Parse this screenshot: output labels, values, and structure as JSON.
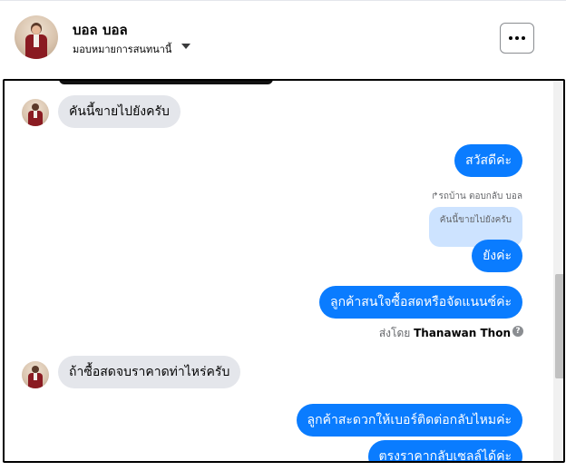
{
  "header": {
    "name": "บอล บอล",
    "assign_label": "มอบหมายการสนทนานี้",
    "more_label": "..."
  },
  "messages": {
    "m1": "คันนี้ขายไปยังครับ",
    "m2": "สวัสดีค่ะ",
    "reply_label": "รถบ้าน ตอบกลับ บอล",
    "quoted": "คันนี้ขายไปยังครับ",
    "m3": "ยังค่ะ",
    "m4": "ลูกค้าสนใจซื้อสดหรือจัดแนนซ์ค่ะ",
    "sent_by_prefix": "ส่งโดย",
    "sent_by_name": "Thanawan Thon",
    "help": "?",
    "m5": "ถ้าซื้อสดจบราคาดท่าไหร่ครับ",
    "m6": "ลูกค้าสะดวกให้เบอร์ติดต่อกลับไหมค่ะ",
    "m7": "ตรงราคากลับเซลล์ได้ค่ะ"
  },
  "icons": {
    "more": "more-dots-icon",
    "caret": "caret-down-icon",
    "reply": "reply-arrow-icon",
    "help": "help-circle-icon"
  },
  "colors": {
    "outgoing": "#0a7cff",
    "incoming": "#e4e6eb",
    "quoted": "#cde3ff"
  }
}
